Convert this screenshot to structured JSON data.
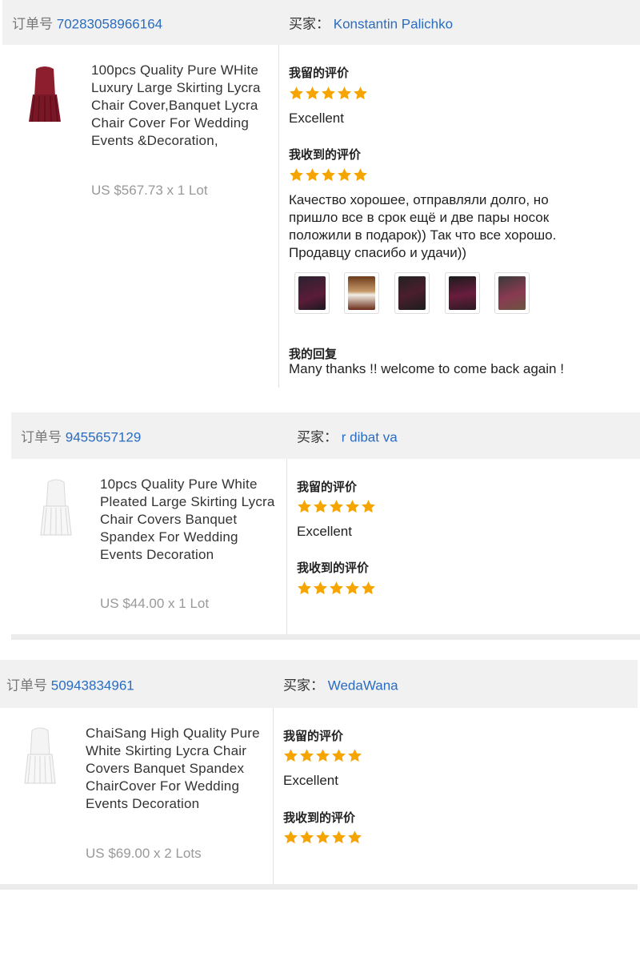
{
  "orders": [
    {
      "order_label": "订单号",
      "order_no": "70283058966164",
      "buyer_label": "买家：",
      "buyer_name": "Konstantin Palichko",
      "product_title": "100pcs Quality Pure WHite Luxury Large Skirting Lycra Chair Cover,Banquet Lycra Chair Cover For Wedding Events &Decoration,",
      "price": "US $567.73 x 1 Lot",
      "given_review_label": "我留的评价",
      "given_review_text": "Excellent",
      "received_review_label": "我收到的评价",
      "received_review_text": "Качество хорошее, отправляли долго, но пришло все в срок ещё и две пары носок положили в подарок)) Так что все хорошо. Продавцу спасибо и удачи))",
      "reply_label": "我的回复",
      "reply_text": "Many thanks !! welcome to come back again !",
      "given_rating": 5,
      "received_rating": 5,
      "photo_count": 5
    },
    {
      "order_label": "订单号",
      "order_no": "9455657129",
      "buyer_label": "买家：",
      "buyer_name": "r  dibat  va",
      "product_title": "10pcs Quality Pure White Pleated Large Skirting Lycra Chair Covers Banquet Spandex For Wedding Events Decoration",
      "price": "US $44.00 x 1 Lot",
      "given_review_label": "我留的评价",
      "given_review_text": "Excellent",
      "received_review_label": "我收到的评价",
      "given_rating": 5,
      "received_rating": 5
    },
    {
      "order_label": "订单号",
      "order_no": "50943834961",
      "buyer_label": "买家：",
      "buyer_name": "WedaWana",
      "product_title": "ChaiSang High Quality Pure White Skirting Lycra Chair Covers Banquet Spandex ChairCover For Wedding Events Decoration",
      "price": "US $69.00 x 2 Lots",
      "given_review_label": "我留的评价",
      "given_review_text": "Excellent",
      "received_review_label": "我收到的评价",
      "given_rating": 5,
      "received_rating": 5
    }
  ],
  "colors": {
    "link": "#2a6cc0",
    "star": "#f5a400",
    "header_bg": "#f1f1f1",
    "burgundy": "#8c1e2e"
  },
  "icons": [
    "star-icon",
    "chair-cover-burgundy-image",
    "chair-cover-white-image"
  ]
}
